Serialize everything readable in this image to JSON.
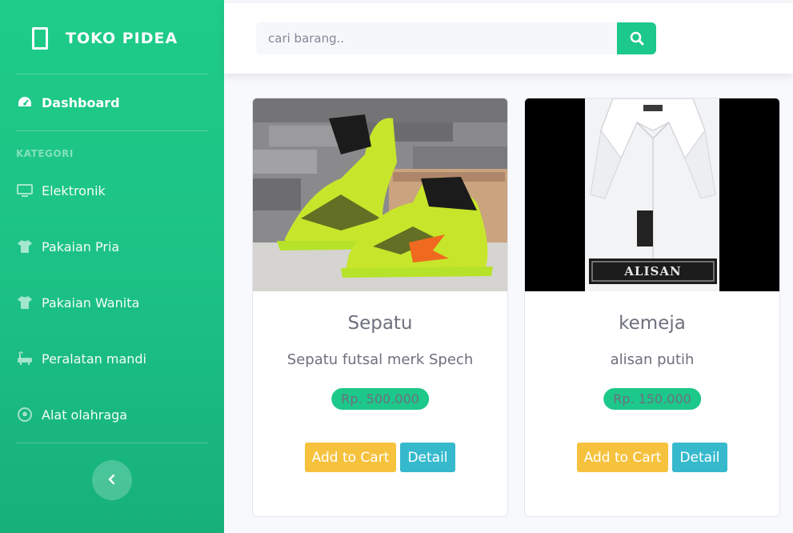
{
  "brand": {
    "name": "TOKO PIDEA",
    "icon": "mobile-phone-icon"
  },
  "sidebar": {
    "dashboard": {
      "label": "Dashboard",
      "icon": "tachometer-icon"
    },
    "heading": "KATEGORI",
    "items": [
      {
        "label": "Elektronik",
        "icon": "desktop-icon"
      },
      {
        "label": "Pakaian Pria",
        "icon": "tshirt-icon"
      },
      {
        "label": "Pakaian Wanita",
        "icon": "tshirt-icon"
      },
      {
        "label": "Peralatan mandi",
        "icon": "bath-icon"
      },
      {
        "label": "Alat olahraga",
        "icon": "football-icon"
      }
    ],
    "toggle_icon": "chevron-left-icon"
  },
  "search": {
    "placeholder": "cari barang..",
    "icon": "search-icon"
  },
  "products": [
    {
      "title": "Sepatu",
      "description": "Sepatu futsal merk Spech",
      "price": "Rp. 500.000",
      "cart_label": "Add to Cart",
      "detail_label": "Detail"
    },
    {
      "title": "kemeja",
      "description": "alisan putih",
      "price": "Rp. 150.000",
      "cart_label": "Add to Cart",
      "detail_label": "Detail",
      "label_text": "ALISAN"
    }
  ],
  "colors": {
    "primary": "#1cc88a",
    "warning": "#f6c23e",
    "info": "#36b9cc",
    "text": "#6e707e"
  }
}
